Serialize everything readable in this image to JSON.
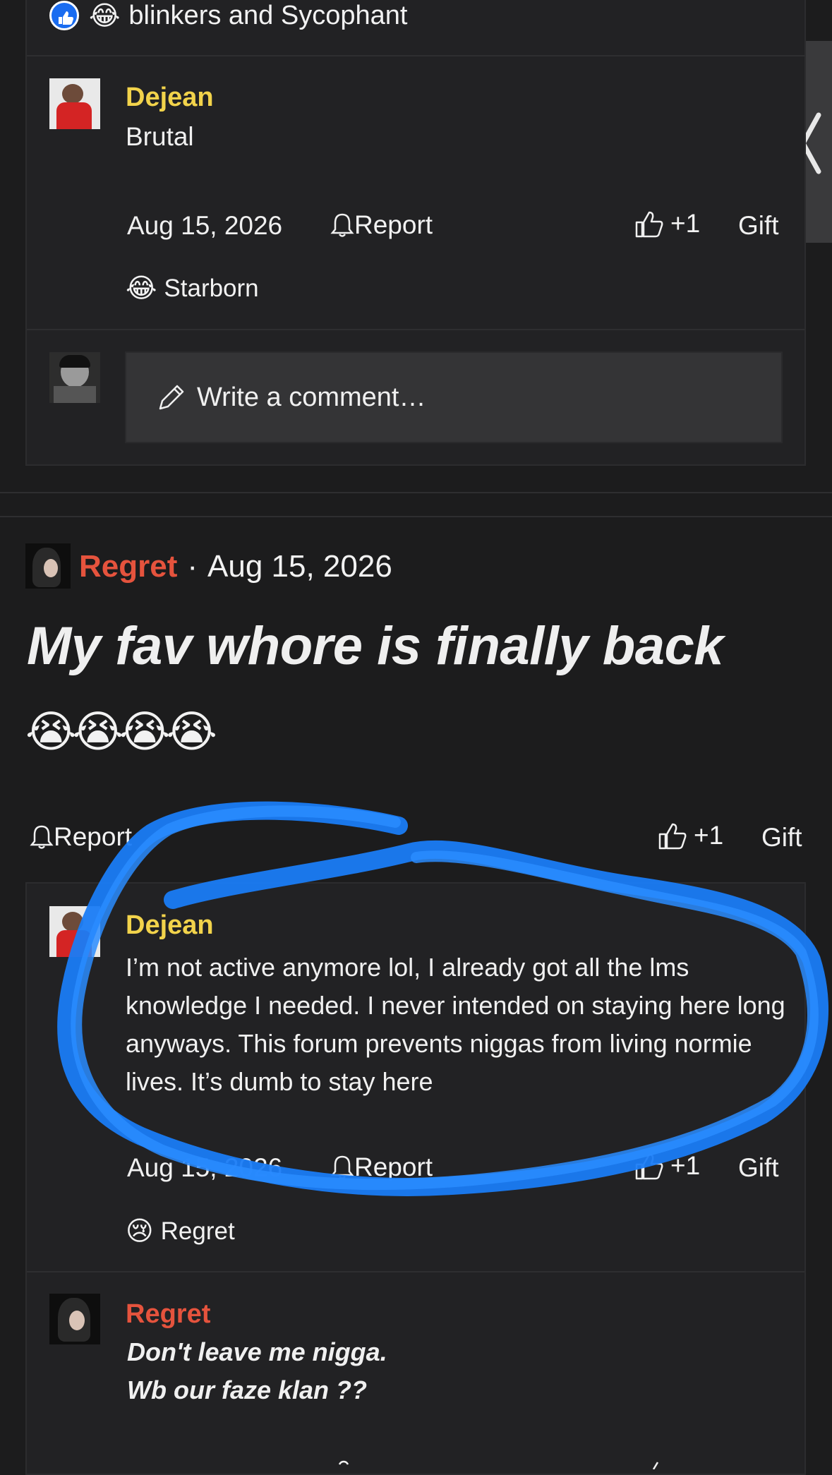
{
  "top_reactions": {
    "text": "blinkers and Sycophant"
  },
  "comment1": {
    "author": "Dejean",
    "body": "Brutal",
    "date": "Aug 15, 2026",
    "report": "Report",
    "like": "+1",
    "gift": "Gift",
    "reaction_user": "Starborn"
  },
  "compose": {
    "placeholder": "Write a comment…"
  },
  "post": {
    "author": "Regret",
    "date_sep": "·",
    "date": "Aug 15, 2026",
    "title": "My fav whore is finally back",
    "emoji_row": "😭😭😭😭",
    "report": "Report",
    "like": "+1",
    "gift": "Gift"
  },
  "comment2": {
    "author": "Dejean",
    "body": "I’m not active anymore lol, I already got all the lms knowledge I needed. I never intended on staying here long anyways. This forum prevents niggas from living normie lives. It’s dumb to stay here",
    "date": "Aug 15, 2026",
    "report": "Report",
    "like": "+1",
    "gift": "Gift",
    "reaction_user": "Regret"
  },
  "comment3": {
    "author": "Regret",
    "line1": "Don't leave me nigga.",
    "line2": "Wb our faze klan ??"
  },
  "colors": {
    "accent_yellow": "#f2d34b",
    "accent_red": "#e5533d",
    "annotation_blue": "#1a7cf5"
  }
}
